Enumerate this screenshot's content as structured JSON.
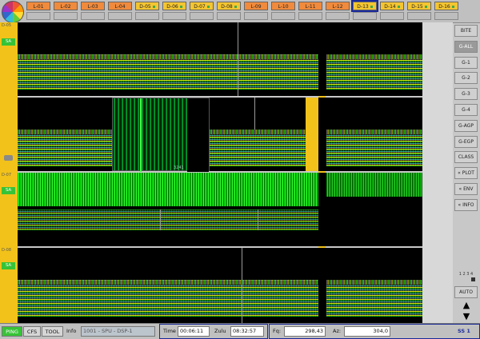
{
  "tabs": [
    {
      "label": "L-01",
      "color": "#f08a3c"
    },
    {
      "label": "L-02",
      "color": "#f08a3c"
    },
    {
      "label": "L-03",
      "color": "#f08a3c"
    },
    {
      "label": "L-04",
      "color": "#f08a3c"
    },
    {
      "label": "D-05",
      "color": "#f4c531"
    },
    {
      "label": "D-06",
      "color": "#f4c531"
    },
    {
      "label": "D-07",
      "color": "#f4c531"
    },
    {
      "label": "D-08",
      "color": "#f4c531"
    },
    {
      "label": "L-09",
      "color": "#f08a3c"
    },
    {
      "label": "L-10",
      "color": "#f08a3c"
    },
    {
      "label": "L-11",
      "color": "#f08a3c"
    },
    {
      "label": "L-12",
      "color": "#f08a3c"
    },
    {
      "label": "D-13",
      "color": "#f4c531"
    },
    {
      "label": "D-14",
      "color": "#f4c531"
    },
    {
      "label": "D-15",
      "color": "#f4c531"
    },
    {
      "label": "D-16",
      "color": "#f4c531"
    }
  ],
  "selected_tab": "D-13",
  "channels": {
    "sa": "SA",
    "ch1": "D-05",
    "ch2": "D-06",
    "ch3": "D-07",
    "ch4": "D-08"
  },
  "mid_scale": "3241",
  "side_buttons": [
    "BITE",
    "G-ALL",
    "G-1",
    "G-2",
    "G-3",
    "G-4",
    "G-AGP",
    "G-EGP",
    "CLASS",
    "« PLOT",
    "« ENV",
    "« INFO"
  ],
  "side_active": "G-ALL",
  "pager": "1 2 3 4",
  "auto_label": "AUTO",
  "bottom": {
    "ping": "PING",
    "cfs": "CFS",
    "tool": "TOOL",
    "info_label": "Info",
    "info_value": "1001 - SPU - DSP-1",
    "time_label": "Time",
    "time_value": "00:06:11",
    "zulu_label": "Zulu",
    "zulu_value": "08:32:57",
    "fq_label": "Fq:",
    "fq_value": "298,43",
    "az_label": "Az:",
    "az_value": "304,0",
    "ss_label": "SS 1"
  },
  "colors": {
    "accent_yellow": "#f2c21a",
    "sa_green": "#37c337",
    "select_blue": "#1a2a9a"
  }
}
